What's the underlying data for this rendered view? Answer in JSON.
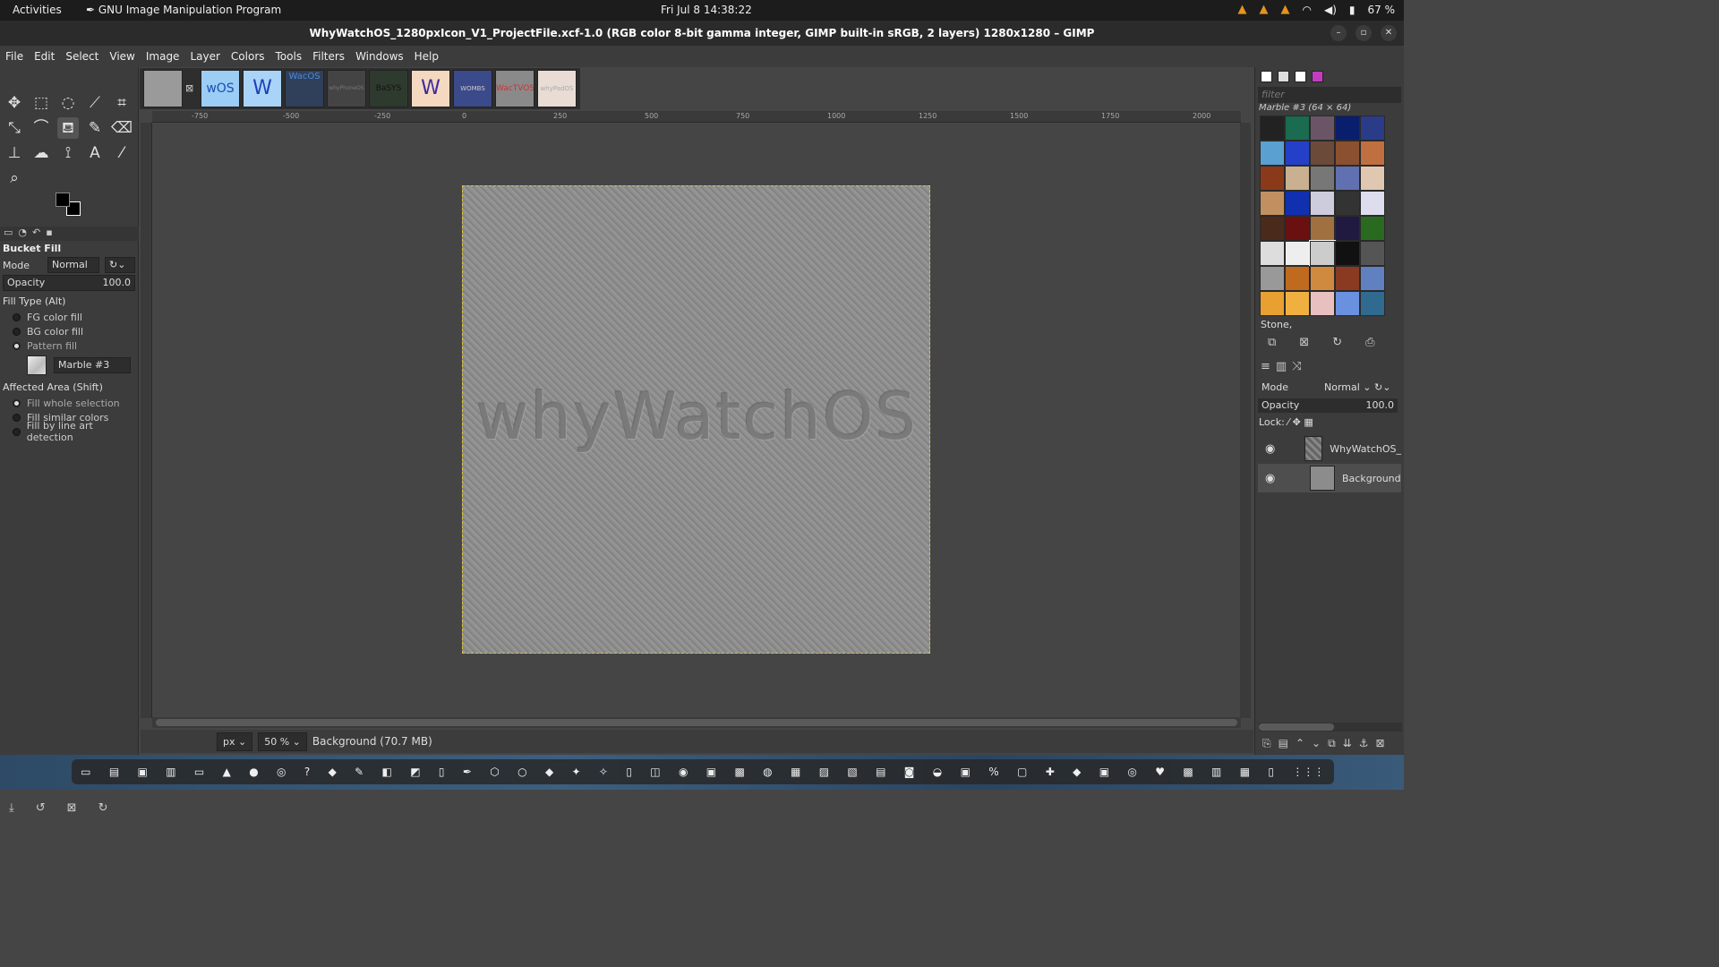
{
  "topbar": {
    "activities": "Activities",
    "app_name": "GNU Image Manipulation Program",
    "clock": "Fri Jul 8  14:38:22",
    "battery": "67 %"
  },
  "window": {
    "title": "WhyWatchOS_1280pxIcon_V1_ProjectFile.xcf-1.0 (RGB color 8-bit gamma integer, GIMP built-in sRGB, 2 layers) 1280x1280 – GIMP"
  },
  "menu": [
    "File",
    "Edit",
    "Select",
    "View",
    "Image",
    "Layer",
    "Colors",
    "Tools",
    "Filters",
    "Windows",
    "Help"
  ],
  "image_tabs": [
    "",
    "wOS",
    "W",
    "WacOS",
    "whyPhoneOS",
    "BaSYS",
    "W",
    "WOMBS",
    "WacTVOS",
    "whyPadOS"
  ],
  "ruler_ticks": [
    "-750",
    "-500",
    "-250",
    "0",
    "250",
    "500",
    "750",
    "1000",
    "1250",
    "1500",
    "1750",
    "2000"
  ],
  "canvas_text": "whyWatchOS",
  "tool_options": {
    "title": "Bucket Fill",
    "mode_label": "Mode",
    "mode_value": "Normal",
    "opacity_label": "Opacity",
    "opacity_value": "100.0",
    "fill_type_label": "Fill Type  (Alt)",
    "fill_fg": "FG color fill",
    "fill_bg": "BG color fill",
    "fill_pattern": "Pattern fill",
    "pattern_name": "Marble #3",
    "affected_label": "Affected Area  (Shift)",
    "area_whole": "Fill whole selection",
    "area_similar": "Fill similar colors",
    "area_lineart": "Fill by line art detection"
  },
  "patterns": {
    "filter_placeholder": "filter",
    "current": "Marble #3 (64 × 64)",
    "tag": "Stone,"
  },
  "layers": {
    "mode_label": "Mode",
    "mode_value": "Normal",
    "opacity_label": "Opacity",
    "opacity_value": "100.0",
    "lock_label": "Lock:",
    "items": [
      {
        "name": "WhyWatchOS_"
      },
      {
        "name": "Background"
      }
    ]
  },
  "status": {
    "unit": "px",
    "zoom": "50 %",
    "info": "Background (70.7 MB)"
  }
}
